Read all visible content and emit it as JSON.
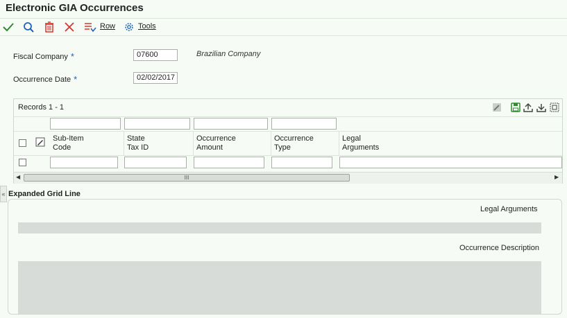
{
  "page": {
    "title": "Electronic GIA Occurrences"
  },
  "toolbar": {
    "row_label": "Row",
    "tools_label": "Tools"
  },
  "form": {
    "fiscal_company_label": "Fiscal Company",
    "fiscal_company_value": "07600",
    "fiscal_company_description": "Brazilian Company",
    "occurrence_date_label": "Occurrence Date",
    "occurrence_date_value": "02/02/2017",
    "required_marker": "*"
  },
  "grid": {
    "records_label": "Records  1 - 1",
    "columns": [
      {
        "line1": "Sub-Item",
        "line2": "Code"
      },
      {
        "line1": "State",
        "line2": "Tax ID"
      },
      {
        "line1": "Occurrence",
        "line2": "Amount"
      },
      {
        "line1": "Occurrence",
        "line2": "Type"
      },
      {
        "line1": "Legal",
        "line2": "Arguments"
      }
    ],
    "scroll_thumb_glyph": "III"
  },
  "expanded": {
    "title": "Expanded Grid Line",
    "legal_arguments_label": "Legal Arguments",
    "occurrence_description_label": "Occurrence Description"
  },
  "colors": {
    "accent_blue": "#1e63b8",
    "ok_green": "#2e8b2e",
    "cancel_red": "#d9342b"
  }
}
